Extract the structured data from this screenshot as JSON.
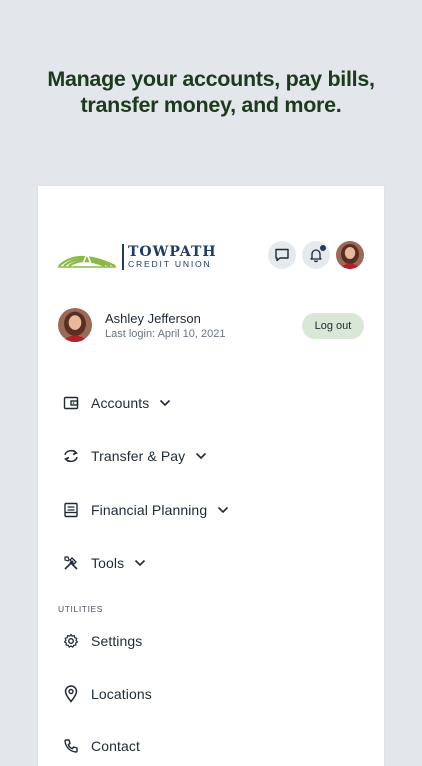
{
  "headline": {
    "line1": "Manage your accounts, pay bills,",
    "line2": "transfer money, and more."
  },
  "header": {
    "logo": {
      "line1": "TOWPATH",
      "line2": "CREDIT UNION"
    },
    "icons": [
      "chat-icon",
      "bell-icon",
      "avatar"
    ],
    "notification_dot": true
  },
  "user": {
    "name": "Ashley Jefferson",
    "last_login": "Last login: April 10, 2021",
    "logout_label": "Log out"
  },
  "nav": [
    {
      "label": "Accounts",
      "icon": "wallet-icon",
      "expandable": true
    },
    {
      "label": "Transfer & Pay",
      "icon": "transfer-icon",
      "expandable": true
    },
    {
      "label": "Financial Planning",
      "icon": "planning-icon",
      "expandable": true
    },
    {
      "label": "Tools",
      "icon": "tools-icon",
      "expandable": true
    }
  ],
  "utilities": {
    "heading": "UTILITIES",
    "items": [
      {
        "label": "Settings",
        "icon": "gear-icon"
      },
      {
        "label": "Locations",
        "icon": "location-pin-icon"
      },
      {
        "label": "Contact",
        "icon": "phone-icon"
      }
    ]
  },
  "colors": {
    "background": "#e3e6ea",
    "headline": "#1c3a1d",
    "brand_navy": "#1f3b66",
    "brand_green": "#8cb84a",
    "logout_bg": "#d9e8d6",
    "icon_bg": "#e6e9ee"
  }
}
